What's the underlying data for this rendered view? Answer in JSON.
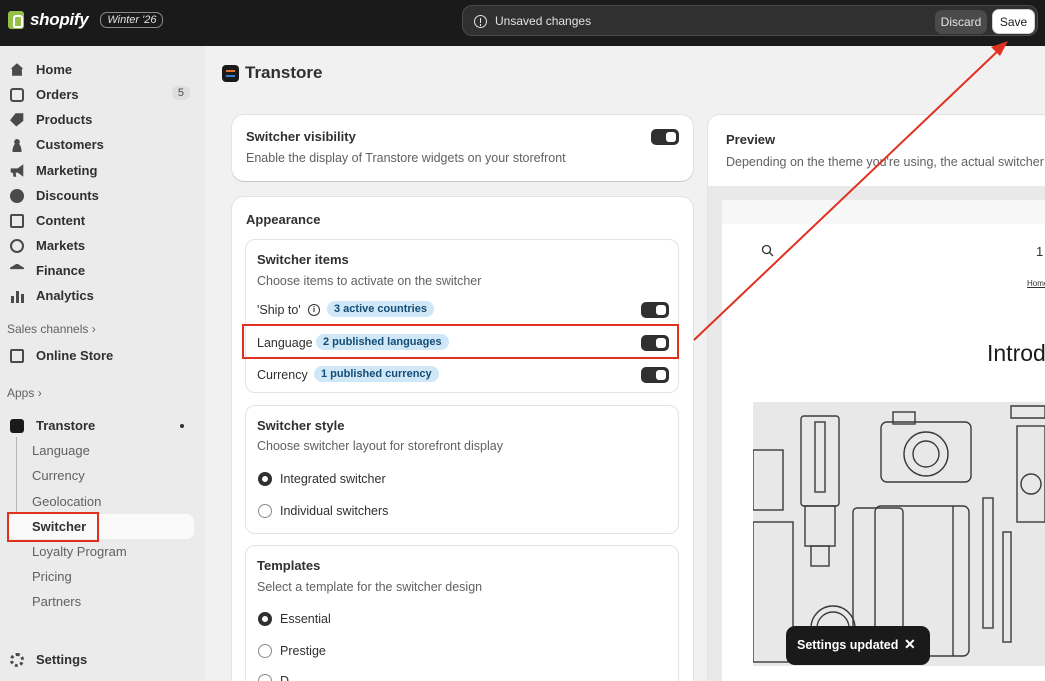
{
  "topbar": {
    "brand": "shopify",
    "edition": "Winter '26",
    "unsaved_text": "Unsaved changes",
    "discard_label": "Discard",
    "save_label": "Save"
  },
  "sidebar": {
    "items": [
      {
        "label": "Home",
        "icon": "home-icon"
      },
      {
        "label": "Orders",
        "icon": "orders-icon",
        "badge": "5"
      },
      {
        "label": "Products",
        "icon": "tag-icon"
      },
      {
        "label": "Customers",
        "icon": "person-icon"
      },
      {
        "label": "Marketing",
        "icon": "megaphone-icon"
      },
      {
        "label": "Discounts",
        "icon": "discount-icon"
      },
      {
        "label": "Content",
        "icon": "content-icon"
      },
      {
        "label": "Markets",
        "icon": "globe-icon"
      },
      {
        "label": "Finance",
        "icon": "bank-icon"
      },
      {
        "label": "Analytics",
        "icon": "bar-chart-icon"
      }
    ],
    "sales_channels_label": "Sales channels",
    "online_store_label": "Online Store",
    "apps_label": "Apps",
    "app_name": "Transtore",
    "app_subitems": [
      "Language",
      "Currency",
      "Geolocation",
      "Switcher",
      "Loyalty Program",
      "Pricing",
      "Partners"
    ],
    "settings_label": "Settings"
  },
  "main": {
    "title": "Transtore",
    "visibility": {
      "heading": "Switcher visibility",
      "description": "Enable the display of Transtore widgets on your storefront"
    },
    "appearance": {
      "heading": "Appearance",
      "items": {
        "heading": "Switcher items",
        "description": "Choose items to activate on the switcher",
        "ship_to_label": "'Ship to'",
        "ship_to_badge": "3 active countries",
        "language_label": "Language",
        "language_badge": "2 published languages",
        "currency_label": "Currency",
        "currency_badge": "1 published currency"
      },
      "style": {
        "heading": "Switcher style",
        "description": "Choose switcher layout for storefront display",
        "options": [
          "Integrated switcher",
          "Individual switchers"
        ]
      },
      "templates": {
        "heading": "Templates",
        "description": "Select a template for the switcher design",
        "options": [
          "Essential",
          "Prestige",
          "D"
        ]
      }
    },
    "preview": {
      "heading": "Preview",
      "description": "Depending on the theme you're using, the actual switcher",
      "store_number": "1",
      "breadcrumb": "Home",
      "heading_text": "Introd"
    }
  },
  "toast": {
    "message": "Settings updated"
  }
}
